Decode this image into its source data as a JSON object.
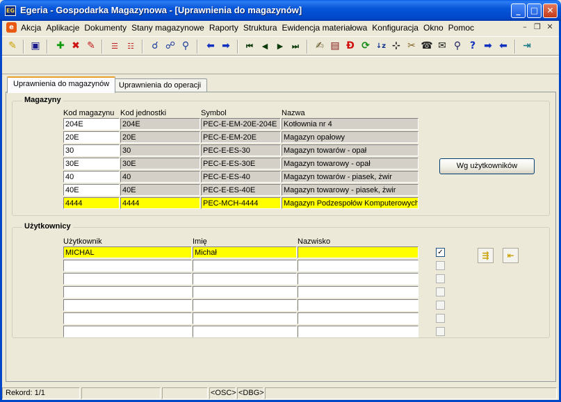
{
  "window": {
    "title": "Egeria - Gospodarka Magazynowa - [Uprawnienia do magazynów]",
    "app_icon": "app-icon",
    "minimize": "_",
    "maximize": "□",
    "close": "✕"
  },
  "menu": {
    "items": [
      "Akcja",
      "Aplikacje",
      "Dokumenty",
      "Stany magazynowe",
      "Raporty",
      "Struktura",
      "Ewidencja materiałowa",
      "Konfiguracja",
      "Okno",
      "Pomoc"
    ],
    "mdi_minimize": "–",
    "mdi_restore": "❐",
    "mdi_close": "✕"
  },
  "toolbar": {
    "icons": [
      "pin-icon",
      "save-icon",
      "add-icon",
      "delete-icon",
      "edit-icon",
      "split-icon",
      "merge-icon",
      "search-icon",
      "search-next-icon",
      "refresh-search-icon",
      "back-icon",
      "forward-icon",
      "first-icon",
      "prev-icon",
      "next-icon",
      "last-icon",
      "note-icon",
      "report-icon",
      "doc-icon",
      "refresh-icon",
      "sort-icon",
      "tree-icon",
      "tools-icon",
      "phone-icon",
      "mail-icon",
      "query-icon",
      "help-icon",
      "nav-right-icon",
      "nav-left-icon",
      "exit-icon"
    ]
  },
  "tabs": [
    {
      "label": "Uprawnienia do magazynów",
      "active": true
    },
    {
      "label": "Uprawnienia do operacji",
      "active": false
    }
  ],
  "magazyny": {
    "legend": "Magazyny",
    "columns": [
      "Kod magazynu",
      "Kod jednostki",
      "Symbol",
      "Nazwa"
    ],
    "rows": [
      {
        "kod": "204E",
        "jednostka": "204E",
        "symbol": "PEC-E-EM-20E-204E",
        "nazwa": "Kotłownia nr 4",
        "selected": false
      },
      {
        "kod": "20E",
        "jednostka": "20E",
        "symbol": "PEC-E-EM-20E",
        "nazwa": "Magazyn opałowy",
        "selected": false
      },
      {
        "kod": "30",
        "jednostka": "30",
        "symbol": "PEC-E-ES-30",
        "nazwa": "Magazyn towarów - opał",
        "selected": false
      },
      {
        "kod": "30E",
        "jednostka": "30E",
        "symbol": "PEC-E-ES-30E",
        "nazwa": "Magazyn towarowy - opał",
        "selected": false
      },
      {
        "kod": "40",
        "jednostka": "40",
        "symbol": "PEC-E-ES-40",
        "nazwa": "Magazyn towarów - piasek, żwir",
        "selected": false
      },
      {
        "kod": "40E",
        "jednostka": "40E",
        "symbol": "PEC-E-ES-40E",
        "nazwa": "Magazyn towarowy - piasek, żwir",
        "selected": false
      },
      {
        "kod": "4444",
        "jednostka": "4444",
        "symbol": "PEC-MCH-4444",
        "nazwa": "Magazyn Podzespołów Komputerowych",
        "selected": true
      }
    ],
    "button": "Wg użytkowników"
  },
  "uzytkownicy": {
    "legend": "Użytkownicy",
    "columns": [
      "Użytkownik",
      "Imię",
      "Nazwisko"
    ],
    "rows": [
      {
        "uzytkownik": "MICHAL",
        "imie": "Michał",
        "nazwisko": "",
        "checked": true,
        "selected": true
      },
      {
        "uzytkownik": "",
        "imie": "",
        "nazwisko": "",
        "checked": false,
        "selected": false
      },
      {
        "uzytkownik": "",
        "imie": "",
        "nazwisko": "",
        "checked": false,
        "selected": false
      },
      {
        "uzytkownik": "",
        "imie": "",
        "nazwisko": "",
        "checked": false,
        "selected": false
      },
      {
        "uzytkownik": "",
        "imie": "",
        "nazwisko": "",
        "checked": false,
        "selected": false
      },
      {
        "uzytkownik": "",
        "imie": "",
        "nazwisko": "",
        "checked": false,
        "selected": false
      },
      {
        "uzytkownik": "",
        "imie": "",
        "nazwisko": "",
        "checked": false,
        "selected": false
      }
    ],
    "add_all_icon": "add-all-icon",
    "remove_all_icon": "remove-all-icon"
  },
  "status": {
    "record": "Rekord: 1/1",
    "osc": "<OSC>",
    "dbg": "<DBG>"
  },
  "colors": {
    "title_bar": "#0047c8",
    "selected_row": "#ffff00",
    "readonly_cell": "#d4d0c8"
  }
}
